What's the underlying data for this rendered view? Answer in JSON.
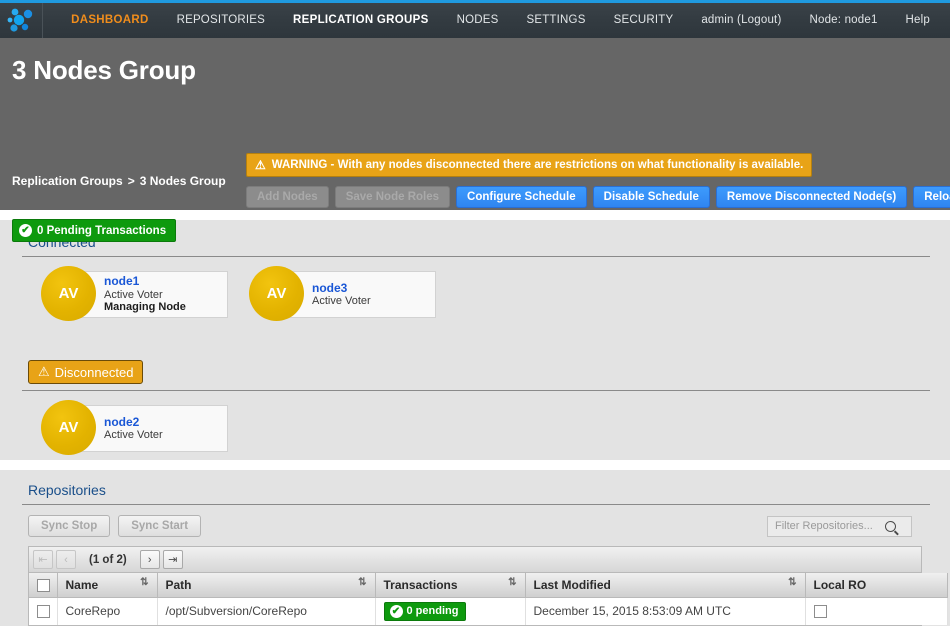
{
  "nav": {
    "logo_icon": "dotcluster-logo-icon",
    "items": [
      {
        "label": "DASHBOARD",
        "style": "active-orange"
      },
      {
        "label": "REPOSITORIES",
        "style": "plain"
      },
      {
        "label": "REPLICATION GROUPS",
        "style": "current"
      },
      {
        "label": "NODES",
        "style": "plain"
      },
      {
        "label": "SETTINGS",
        "style": "plain"
      },
      {
        "label": "SECURITY",
        "style": "plain"
      }
    ],
    "right": [
      {
        "label": "admin (Logout)"
      },
      {
        "label": "Node: node1"
      },
      {
        "label": "Help"
      }
    ],
    "accent_orange": "#f08d1c",
    "top_border": "#1f9ae0"
  },
  "header": {
    "title": "3 Nodes Group",
    "breadcrumb_root": "Replication Groups",
    "breadcrumb_sep": ">",
    "breadcrumb_current": "3 Nodes Group",
    "pending_badge": "0 Pending Transactions",
    "pending_icon": "check-circle-icon",
    "warning_icon": "warning-triangle-icon",
    "warning_text": "WARNING - With any nodes disconnected there are restrictions on what functionality is available.",
    "warning_color": "#e8a317",
    "buttons": [
      {
        "label": "Add Nodes",
        "enabled": false
      },
      {
        "label": "Save Node Roles",
        "enabled": false
      },
      {
        "label": "Configure Schedule",
        "enabled": true
      },
      {
        "label": "Disable Schedule",
        "enabled": true
      },
      {
        "label": "Remove Disconnected Node(s)",
        "enabled": true
      },
      {
        "label": "Reload",
        "enabled": true
      }
    ]
  },
  "connected": {
    "title": "Connected",
    "nodes": [
      {
        "initials": "AV",
        "name": "node1",
        "role": "Active Voter",
        "extra": "Managing Node"
      },
      {
        "initials": "AV",
        "name": "node3",
        "role": "Active Voter",
        "extra": ""
      }
    ]
  },
  "disconnected": {
    "title": "Disconnected",
    "icon": "warning-triangle-icon",
    "nodes": [
      {
        "initials": "AV",
        "name": "node2",
        "role": "Active Voter",
        "extra": ""
      }
    ]
  },
  "repositories": {
    "title": "Repositories",
    "buttons": [
      {
        "label": "Sync Stop"
      },
      {
        "label": "Sync Start"
      }
    ],
    "filter_placeholder": "Filter Repositories...",
    "filter_value": "",
    "search_icon": "search-icon",
    "pagination": {
      "first": "⇤",
      "prev": "‹",
      "count": "(1 of 2)",
      "next": "›",
      "last": "⇥"
    },
    "columns": [
      {
        "label": "",
        "sortable": false
      },
      {
        "label": "Name",
        "sortable": true
      },
      {
        "label": "Path",
        "sortable": true
      },
      {
        "label": "Transactions",
        "sortable": true
      },
      {
        "label": "Last Modified",
        "sortable": true
      },
      {
        "label": "Local RO",
        "sortable": false
      }
    ],
    "rows": [
      {
        "name": "CoreRepo",
        "path": "/opt/Subversion/CoreRepo",
        "transactions": "0 pending",
        "transactions_icon": "check-circle-icon",
        "last_modified": "December 15, 2015 8:53:09 AM UTC",
        "local_ro": false
      }
    ]
  }
}
